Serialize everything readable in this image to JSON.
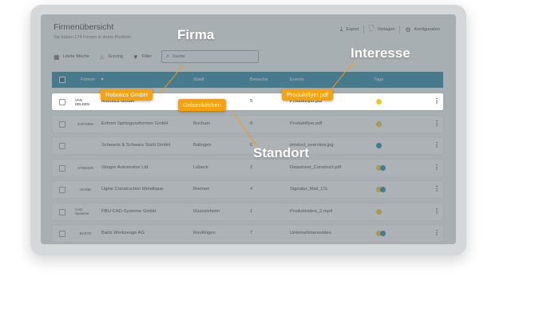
{
  "page": {
    "title": "Firmenübersicht",
    "subtitle": "Sie haben 174 Firmen in ihrem Portfolio"
  },
  "actions": {
    "export": "Export",
    "vorlagen": "Vorlagen",
    "konfiguration": "Konfiguration"
  },
  "toolbar": {
    "period": "Letzte Woche",
    "scoring": "Scoring",
    "filter": "Filter",
    "search_placeholder": "Suche"
  },
  "table": {
    "headers": {
      "firmen": "Firmen",
      "stadt": "Stadt",
      "besuche": "Besuche",
      "events": "Events",
      "tags": "Tags"
    },
    "rows": [
      {
        "logo": "VAN DELDEN",
        "name": "Robotics GmbH",
        "stadt": "Gelsenkirchen",
        "besuche": "5",
        "event": "Produktflyer.pdf",
        "tags": [
          "#f2c81a"
        ]
      },
      {
        "logo": "EXFORM",
        "name": "Exform Spritzgussformen GmbH",
        "stadt": "Bochum",
        "besuche": "8",
        "event": "Produktflyer.pdf",
        "tags": [
          "#f2c81a"
        ]
      },
      {
        "logo": "",
        "name": "Schwartz & Schwarz Stahl GmbH",
        "stadt": "Balingen",
        "besuche": "6",
        "event": "product_overview.jpg",
        "tags": [
          "#1c7fa3"
        ]
      },
      {
        "logo": "STINGER",
        "name": "Stinger Automotive Ltd.",
        "stadt": "Lübeck",
        "besuche": "2",
        "event": "Datasheet_Construct.pdf",
        "tags": [
          "#f2c81a",
          "#1c7fa3"
        ]
      },
      {
        "logo": "UGINE",
        "name": "Ugine Construction Metallique",
        "stadt": "Bremen",
        "besuche": "4",
        "event": "Signatur_Mail_CS",
        "tags": [
          "#f2c81a",
          "#1c7fa3"
        ]
      },
      {
        "logo": "CAD Systeme",
        "name": "PBU CAD-Systeme GmbH",
        "stadt": "Rüsselsheim",
        "besuche": "1",
        "event": "Produktvideo_2.mp4",
        "tags": [
          "#f2c81a"
        ]
      },
      {
        "logo": "BARTZ",
        "name": "Bartz Werkzeuge AG",
        "stadt": "Reutlingen",
        "besuche": "7",
        "event": "Unternehmensvideo",
        "tags": [
          "#f2c81a",
          "#1c7fa3"
        ]
      }
    ]
  },
  "annotations": {
    "firma": "Firma",
    "interesse": "Interesse",
    "standort": "Standort"
  },
  "colors": {
    "header": "#1c7fa3",
    "tag_yellow": "#f2c81a",
    "tag_blue": "#1c7fa3",
    "callout": "#f4a20f"
  }
}
